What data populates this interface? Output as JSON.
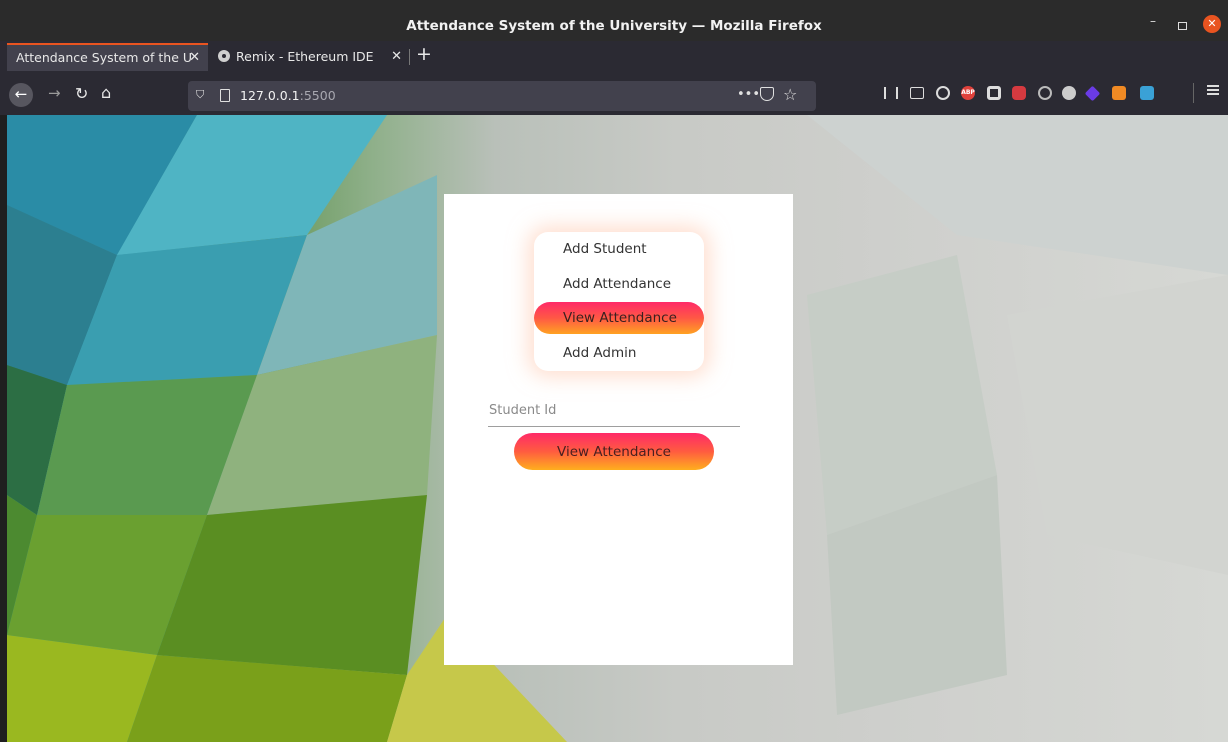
{
  "window": {
    "title": "Attendance System of the University — Mozilla Firefox",
    "controls": {
      "minimize": "–",
      "close": "✕"
    }
  },
  "tabs": [
    {
      "label": "Attendance System of the U",
      "active": true
    },
    {
      "label": "Remix - Ethereum IDE",
      "active": false
    }
  ],
  "tab_close_glyph": "✕",
  "newtab_glyph": "+",
  "navbar": {
    "url_host": "127.0.0.1",
    "url_port": ":5500",
    "more_glyph": "•••"
  },
  "extensions": [
    "library-icon",
    "sidebar-icon",
    "account-icon",
    "adblock-plus-icon",
    "dark-reader-icon",
    "video-icon",
    "privacy-icon",
    "globe-icon",
    "purple-extension-icon",
    "metamask-icon",
    "blue-extension-icon"
  ],
  "extension_labels": {
    "abp": "ABP"
  },
  "app": {
    "menu": [
      {
        "label": "Add Student",
        "active": false
      },
      {
        "label": "Add Attendance",
        "active": false
      },
      {
        "label": "View Attendance",
        "active": true
      },
      {
        "label": "Add Admin",
        "active": false
      }
    ],
    "student_id": {
      "placeholder": "Student Id",
      "value": ""
    },
    "submit_label": "View Attendance"
  },
  "colors": {
    "accent_top": "#ff2a68",
    "accent_bottom": "#ffa222",
    "firefox_tab_accent": "#e95420",
    "card_bg": "#ffffff"
  }
}
